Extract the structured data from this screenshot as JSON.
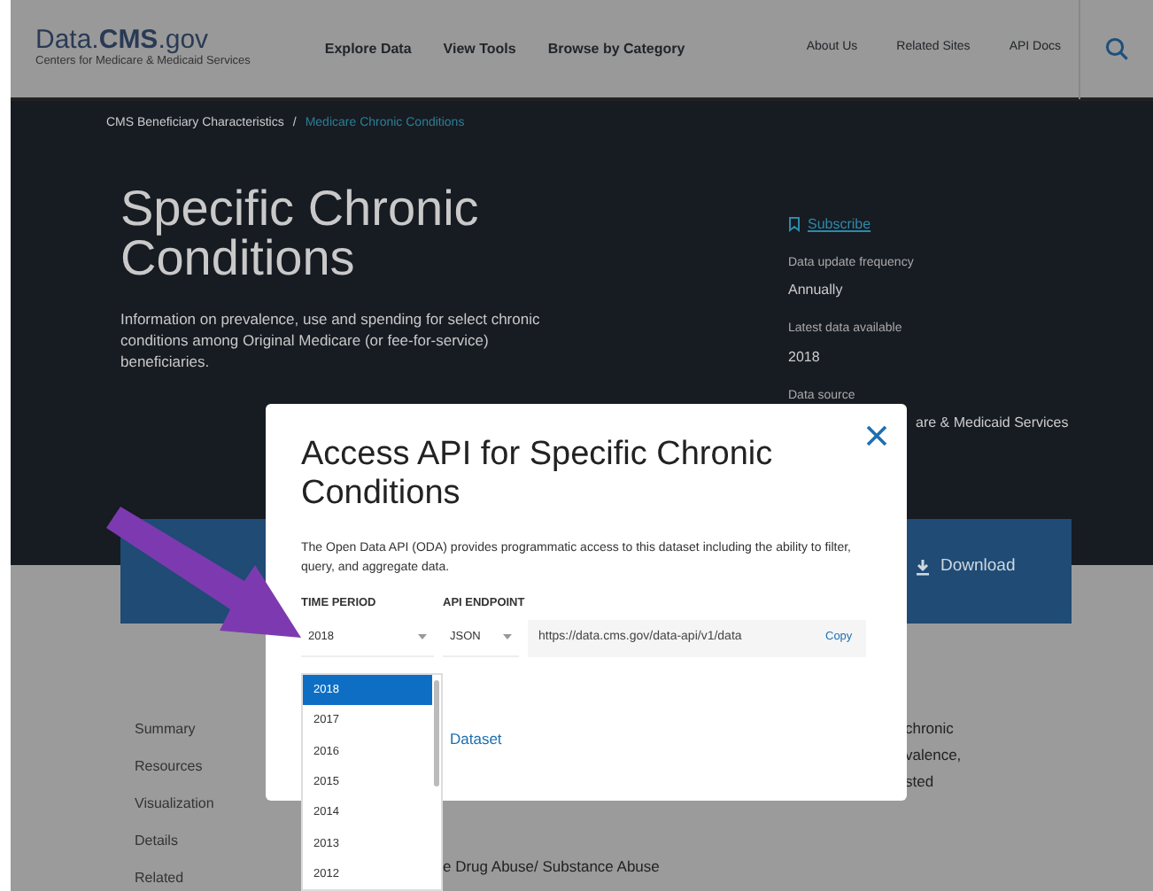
{
  "header": {
    "logo": "Data.**CMS**.gov",
    "logo_subtitle": "Centers for Medicare & Medicaid Services",
    "primary_nav": [
      "Explore Data",
      "View Tools",
      "Browse by Category"
    ],
    "secondary_nav": [
      "About Us",
      "Related Sites",
      "API Docs"
    ]
  },
  "breadcrumb_separator": "/",
  "breadcrumb": [
    "CMS Beneficiary Characteristics",
    "Medicare Chronic Conditions"
  ],
  "hero": {
    "title": "Specific Chronic Conditions",
    "description": "Information on prevalence, use and spending for select chronic conditions among Original Medicare (or fee-for-service) beneficiaries.",
    "subscribe": "Subscribe",
    "meta": [
      {
        "label": "Data update frequency",
        "value": "Annually"
      },
      {
        "label": "Latest data available",
        "value": "2018"
      },
      {
        "label": "Data source",
        "value": "are & Medicaid Services"
      }
    ]
  },
  "download_button": "Download",
  "sidebar": [
    "Summary",
    "Resources",
    "Visualization",
    "Details",
    "Related"
  ],
  "body_fragments": [
    "chronic",
    "valence,",
    "sted"
  ],
  "body_line": "e Drug Abuse/ Substance Abuse",
  "modal": {
    "title": "Access API for Specific Chronic Conditions",
    "description": "The Open Data API (ODA) provides programmatic access to this dataset including the ability to filter, query, and aggregate data.",
    "time_period": {
      "label": "TIME PERIOD",
      "value": "2018"
    },
    "api_endpoint": {
      "label": "API ENDPOINT",
      "format": "JSON",
      "url": "https://data.cms.gov/data-api/v1/data"
    },
    "copy_button": "Copy",
    "link": "Dataset",
    "dropdown": [
      {
        "label": "2018",
        "selected": true
      },
      {
        "label": "2017",
        "selected": false
      },
      {
        "label": "2016",
        "selected": false
      },
      {
        "label": "2015",
        "selected": false
      },
      {
        "label": "2014",
        "selected": false
      },
      {
        "label": "2013",
        "selected": false
      },
      {
        "label": "2012",
        "selected": false
      }
    ]
  }
}
